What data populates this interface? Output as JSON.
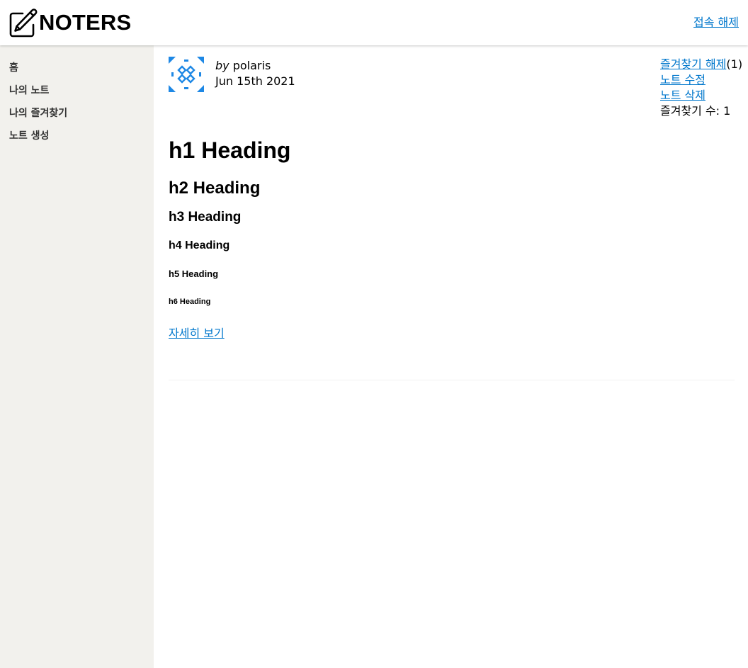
{
  "header": {
    "logo_text": "NOTERS",
    "logo_icon": "pencil-square-icon",
    "logout_label": "접속 해제"
  },
  "sidebar": {
    "items": [
      {
        "label": "홈"
      },
      {
        "label": "나의 노트"
      },
      {
        "label": "나의 즐겨찾기"
      },
      {
        "label": "노트 생성"
      }
    ]
  },
  "note": {
    "avatar_icon": "identicon-avatar",
    "by_label": "by",
    "author": "polaris",
    "date": "Jun 15th 2021",
    "actions": {
      "unfavorite_label": "즐겨찾기 해제",
      "favorite_count_paren": "(1)",
      "edit_label": "노트 수정",
      "delete_label": "노트 삭제",
      "favorite_count_text": "즐겨찾기 수: 1"
    },
    "content": {
      "h1": "h1 Heading",
      "h2": "h2 Heading",
      "h3": "h3 Heading",
      "h4": "h4 Heading",
      "h5": "h5 Heading",
      "h6": "h6 Heading"
    },
    "more_label": "자세히 보기"
  },
  "colors": {
    "link": "#0077cc",
    "sidebar_bg": "#f2f1ed",
    "avatar": "#1e88e5"
  }
}
